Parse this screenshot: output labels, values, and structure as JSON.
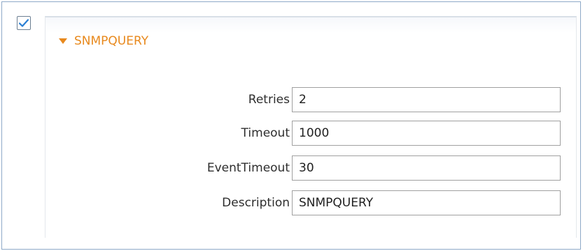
{
  "enabled": true,
  "section": {
    "title": "SNMPQUERY",
    "expanded": true,
    "accent_color": "#e8891d",
    "toggle_icon": "triangle-down-icon"
  },
  "fields": {
    "retries": {
      "label": "Retries",
      "value": "2"
    },
    "timeout": {
      "label": "Timeout",
      "value": "1000"
    },
    "event_timeout": {
      "label": "EventTimeout",
      "value": "30"
    },
    "description": {
      "label": "Description",
      "value": "SNMPQUERY"
    }
  }
}
